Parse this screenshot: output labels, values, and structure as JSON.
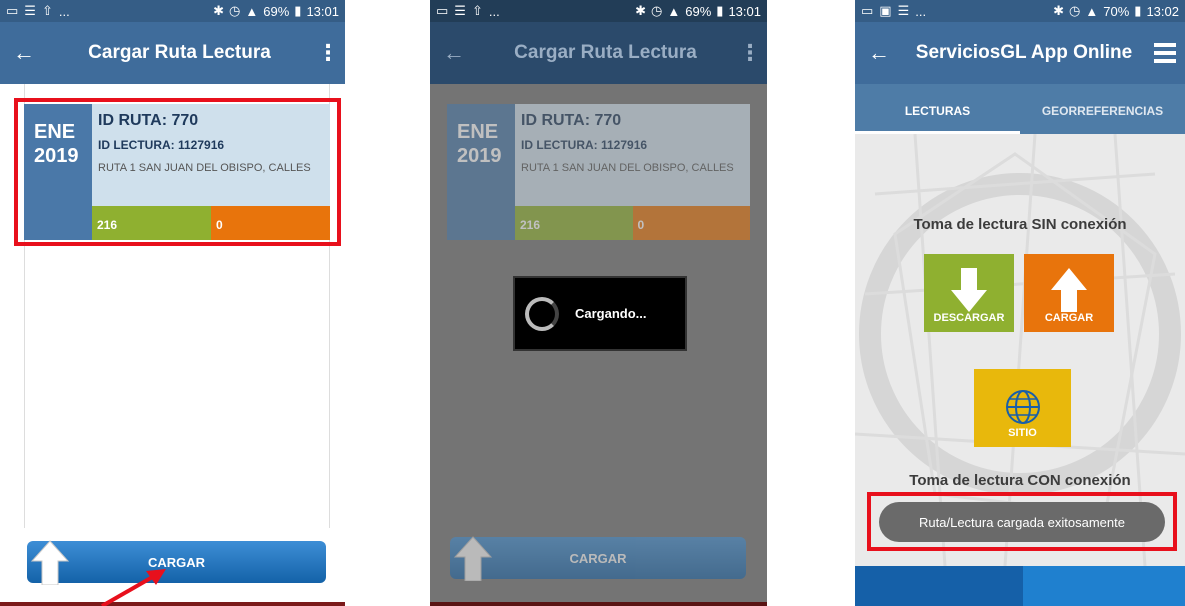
{
  "colors": {
    "appbar": "#3f6c9b",
    "statusbar": "#355d86",
    "highlight": "#e8101c",
    "green": "#8fb030",
    "orange": "#e8740c",
    "yellow": "#e8b80c",
    "button_blue": "#1a6fb8"
  },
  "screen1": {
    "status_left_icons": [
      "notification-icon",
      "list-icon",
      "upload-icon"
    ],
    "status_left_more": "...",
    "status_right": "69%",
    "status_time": "13:01",
    "title": "Cargar Ruta Lectura",
    "back_label": "←",
    "menu_label": "⋮",
    "card": {
      "month": "ENE",
      "year": "2019",
      "route_id": "ID RUTA: 770",
      "reading_id": "ID LECTURA: 1127916",
      "route_name": "RUTA 1 SAN JUAN DEL OBISPO, CALLES",
      "count_green": "216",
      "count_orange": "0"
    },
    "button_label": "CARGAR"
  },
  "screen2": {
    "status_right": "69%",
    "status_time": "13:01",
    "title": "Cargar Ruta Lectura",
    "back_label": "←",
    "menu_label": "⋮",
    "card": {
      "month": "ENE",
      "year": "2019",
      "route_id": "ID RUTA: 770",
      "reading_id": "ID LECTURA: 1127916",
      "route_name": "RUTA 1 SAN JUAN DEL OBISPO, CALLES",
      "count_green": "216",
      "count_orange": "0"
    },
    "loading_text": "Cargando...",
    "button_label": "CARGAR"
  },
  "screen3": {
    "status_right": "70%",
    "status_time": "13:02",
    "title": "ServiciosGL App Online",
    "back_label": "←",
    "tabs": [
      {
        "label": "LECTURAS",
        "active": true
      },
      {
        "label": "GEORREFERENCIAS",
        "active": false
      }
    ],
    "section_offline": "Toma de lectura SIN conexión",
    "tile_descargar": "DESCARGAR",
    "tile_cargar": "CARGAR",
    "tile_sitio": "SITIO",
    "section_online": "Toma de lectura CON conexión",
    "toast": "Ruta/Lectura cargada exitosamente"
  }
}
